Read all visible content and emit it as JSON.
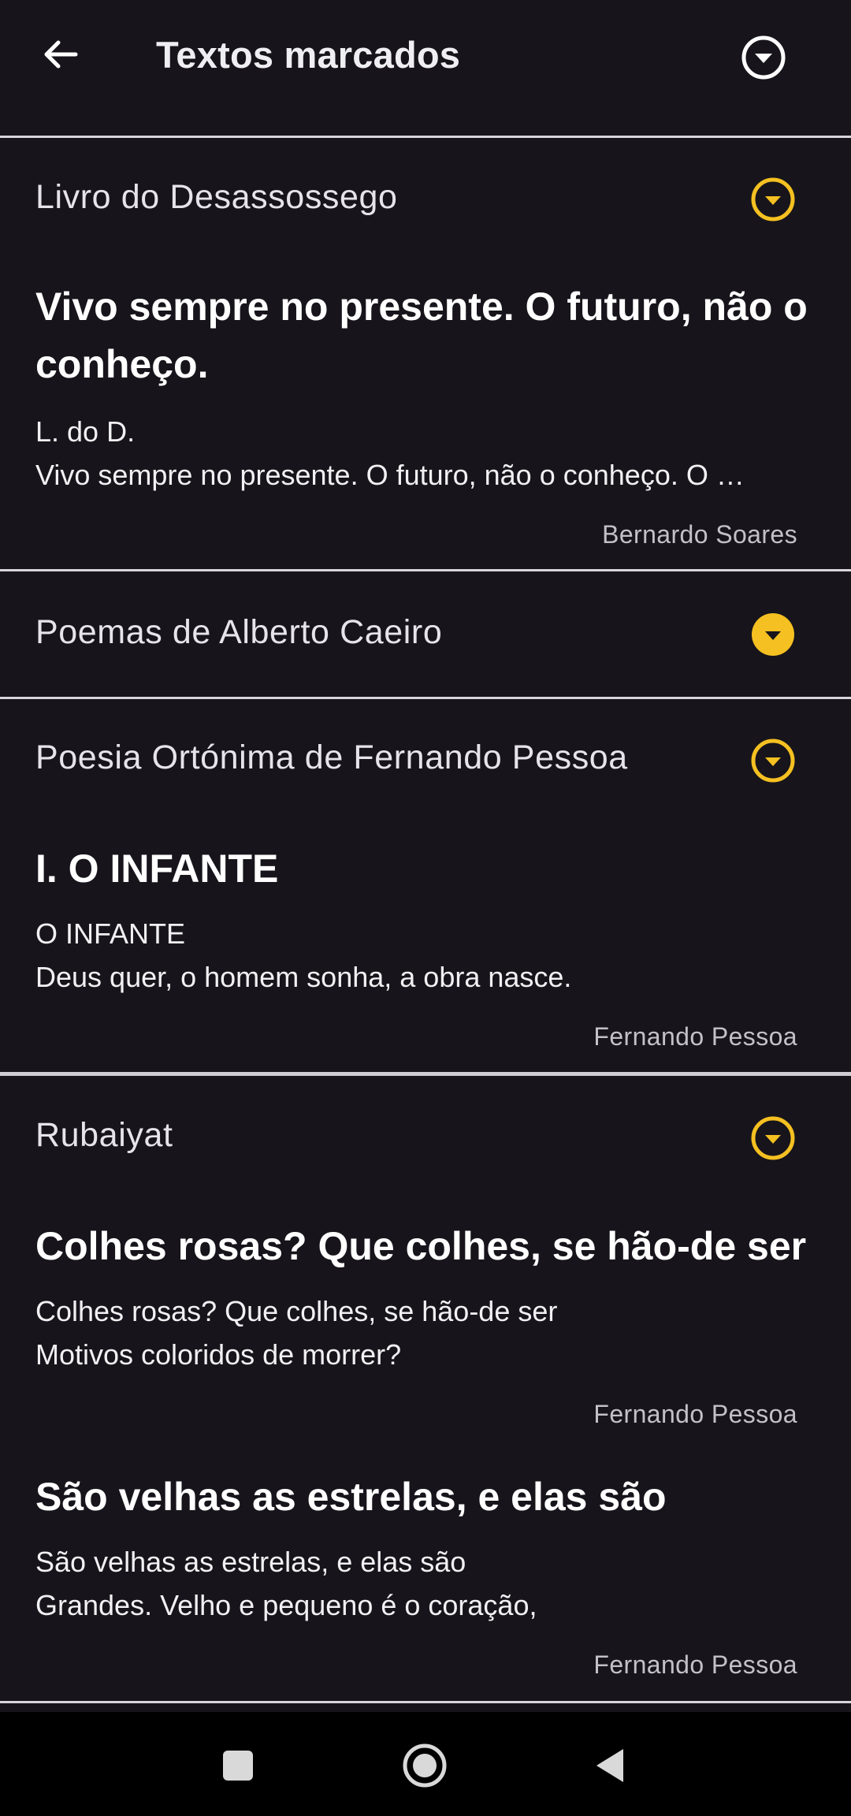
{
  "header": {
    "title": "Textos marcados",
    "back_icon": "arrow-left-icon",
    "toggle_icon": "chevron-circle-down-icon"
  },
  "colors": {
    "background": "#17151b",
    "accent": "#f5c021",
    "divider": "#d8d6dc"
  },
  "sections": [
    {
      "title": "Livro do Desassossego",
      "expanded": true,
      "entries": [
        {
          "title": "Vivo sempre no presente. O futuro, não o conheço.",
          "lines": [
            "L. do D.",
            "Vivo sempre no presente. O futuro, não o conheço. O …"
          ],
          "author": "Bernardo Soares"
        }
      ]
    },
    {
      "title": "Poemas de Alberto Caeiro",
      "expanded": false,
      "entries": []
    },
    {
      "title": "Poesia Ortónima de Fernando Pessoa",
      "expanded": true,
      "entries": [
        {
          "title": "I. O INFANTE",
          "lines": [
            "O INFANTE",
            "Deus quer, o homem sonha, a obra nasce."
          ],
          "author": "Fernando Pessoa"
        }
      ]
    },
    {
      "title": "Rubaiyat",
      "expanded": true,
      "entries": [
        {
          "title": "Colhes rosas? Que colhes, se hão-de ser",
          "lines": [
            "Colhes rosas? Que colhes, se hão-de ser",
            "Motivos coloridos de morrer?"
          ],
          "author": "Fernando Pessoa"
        },
        {
          "title": "São velhas as estrelas, e elas são",
          "lines": [
            "São velhas as estrelas, e elas são",
            "Grandes. Velho e pequeno é o coração,"
          ],
          "author": "Fernando Pessoa"
        }
      ]
    }
  ],
  "navbar": {
    "recents_icon": "square-icon",
    "home_icon": "circle-home-icon",
    "back_icon": "triangle-back-icon"
  }
}
